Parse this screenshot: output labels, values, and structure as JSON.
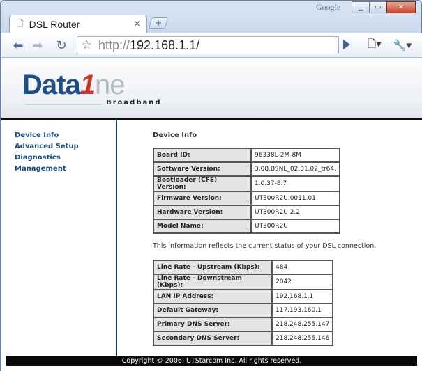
{
  "browser": {
    "brand": "Google",
    "tab_title": "DSL Router",
    "url_scheme": "http://",
    "url_host": "192.168.1.1/"
  },
  "logo": {
    "main": "Data",
    "one": "ne",
    "sub": "Broadband"
  },
  "nav": [
    "Device Info",
    "Advanced Setup",
    "Diagnostics",
    "Management"
  ],
  "page": {
    "title": "Device Info",
    "device_table": [
      {
        "key": "Board ID:",
        "value": "96338L-2M-8M"
      },
      {
        "key": "Software Version:",
        "value": "3.08.BSNL_02.01.02_tr64."
      },
      {
        "key": "Bootloader (CFE) Version:",
        "value": "1.0.37-8.7"
      },
      {
        "key": "Firmware Version:",
        "value": "UT300R2U.0011.01"
      },
      {
        "key": "Hardware Version:",
        "value": "UT300R2U 2.2"
      },
      {
        "key": "Model Name:",
        "value": "UT300R2U"
      }
    ],
    "info_text": "This information reflects the current status of your DSL connection.",
    "status_table": [
      {
        "key": "Line Rate - Upstream (Kbps):",
        "value": "484"
      },
      {
        "key": "Line Rate - Downstream (Kbps):",
        "value": "2042"
      },
      {
        "key": "LAN IP Address:",
        "value": "192.168.1.1"
      },
      {
        "key": "Default Gateway:",
        "value": "117.193.160.1"
      },
      {
        "key": "Primary DNS Server:",
        "value": "218.248.255.147"
      },
      {
        "key": "Secondary DNS Server:",
        "value": "218.248.255.146"
      }
    ]
  },
  "footer": "Copyright © 2006, UTStarcom Inc. All rights reserved."
}
